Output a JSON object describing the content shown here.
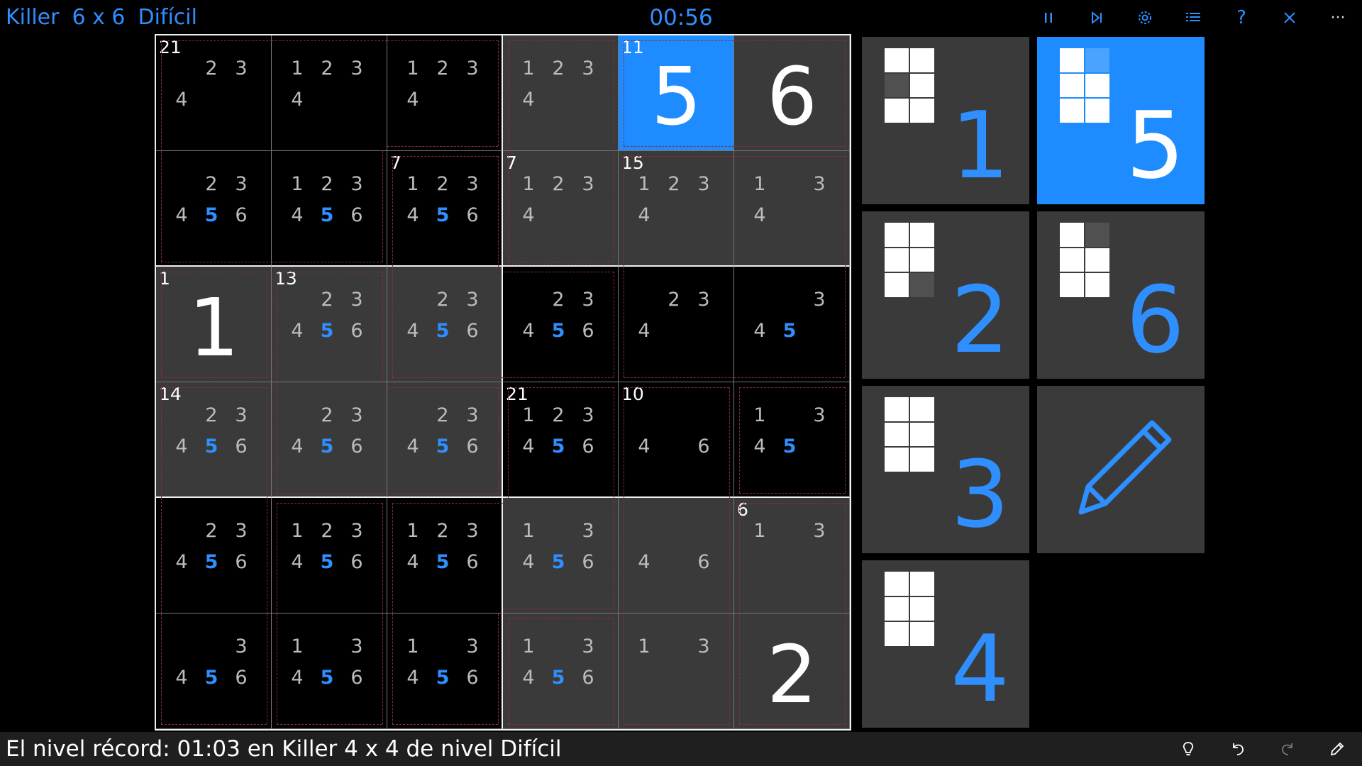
{
  "header": {
    "game_name": "Killer",
    "size": "6 x 6",
    "difficulty": "Difícil",
    "timer": "00:56",
    "icons": [
      "pause-icon",
      "skip-icon",
      "settings-icon",
      "list-icon",
      "help-icon",
      "close-icon",
      "more-icon"
    ],
    "more_label": "···",
    "help_label": "?"
  },
  "colors": {
    "accent": "#2f8fff",
    "selected_cell": "#1e8cff",
    "dark_cell": "#000000",
    "gray_cell": "#3a3a3a",
    "cage_border": "#8c2c3c"
  },
  "board": {
    "selected": [
      0,
      4
    ],
    "shade": [
      [
        0,
        0,
        0,
        1,
        1,
        1
      ],
      [
        0,
        0,
        0,
        1,
        1,
        1
      ],
      [
        1,
        1,
        1,
        0,
        0,
        0
      ],
      [
        1,
        1,
        1,
        0,
        0,
        0
      ],
      [
        0,
        0,
        0,
        1,
        1,
        1
      ],
      [
        0,
        0,
        0,
        1,
        1,
        1
      ]
    ],
    "cells": [
      [
        {
          "sum": "21",
          "cands": [
            "",
            "2",
            "3",
            "4",
            "",
            ""
          ],
          "hl": []
        },
        {
          "sum": "",
          "cands": [
            "1",
            "2",
            "3",
            "4",
            "",
            ""
          ],
          "hl": []
        },
        {
          "sum": "",
          "cands": [
            "1",
            "2",
            "3",
            "4",
            "",
            ""
          ],
          "hl": []
        },
        {
          "sum": "",
          "cands": [
            "1",
            "2",
            "3",
            "4",
            "",
            ""
          ],
          "hl": []
        },
        {
          "sum": "11",
          "value": "5"
        },
        {
          "sum": "",
          "value": "6"
        }
      ],
      [
        {
          "sum": "",
          "cands": [
            "",
            "2",
            "3",
            "4",
            "5",
            "6"
          ],
          "hl": [
            4
          ]
        },
        {
          "sum": "",
          "cands": [
            "1",
            "2",
            "3",
            "4",
            "5",
            "6"
          ],
          "hl": [
            4
          ]
        },
        {
          "sum": "7",
          "cands": [
            "1",
            "2",
            "3",
            "4",
            "5",
            "6"
          ],
          "hl": [
            4
          ]
        },
        {
          "sum": "7",
          "cands": [
            "1",
            "2",
            "3",
            "4",
            "",
            ""
          ],
          "hl": []
        },
        {
          "sum": "15",
          "cands": [
            "1",
            "2",
            "3",
            "4",
            "",
            ""
          ],
          "hl": []
        },
        {
          "sum": "",
          "cands": [
            "1",
            "",
            "3",
            "4",
            "",
            ""
          ],
          "hl": []
        }
      ],
      [
        {
          "sum": "1",
          "value": "1"
        },
        {
          "sum": "13",
          "cands": [
            "",
            "2",
            "3",
            "4",
            "5",
            "6"
          ],
          "hl": [
            4
          ]
        },
        {
          "sum": "",
          "cands": [
            "",
            "2",
            "3",
            "4",
            "5",
            "6"
          ],
          "hl": [
            4
          ]
        },
        {
          "sum": "",
          "cands": [
            "",
            "2",
            "3",
            "4",
            "5",
            "6"
          ],
          "hl": [
            4
          ]
        },
        {
          "sum": "",
          "cands": [
            "",
            "2",
            "3",
            "4",
            "",
            ""
          ],
          "hl": []
        },
        {
          "sum": "",
          "cands": [
            "",
            "",
            "3",
            "4",
            "5",
            ""
          ],
          "hl": [
            4
          ]
        }
      ],
      [
        {
          "sum": "14",
          "cands": [
            "",
            "2",
            "3",
            "4",
            "5",
            "6"
          ],
          "hl": [
            4
          ]
        },
        {
          "sum": "",
          "cands": [
            "",
            "2",
            "3",
            "4",
            "5",
            "6"
          ],
          "hl": [
            4
          ]
        },
        {
          "sum": "",
          "cands": [
            "",
            "2",
            "3",
            "4",
            "5",
            "6"
          ],
          "hl": [
            4
          ]
        },
        {
          "sum": "21",
          "cands": [
            "1",
            "2",
            "3",
            "4",
            "5",
            "6"
          ],
          "hl": [
            4
          ]
        },
        {
          "sum": "10",
          "cands": [
            "",
            "",
            "",
            "4",
            "",
            "6"
          ],
          "hl": []
        },
        {
          "sum": "",
          "cands": [
            "1",
            "",
            "3",
            "4",
            "5",
            ""
          ],
          "hl": [
            4
          ]
        }
      ],
      [
        {
          "sum": "",
          "cands": [
            "",
            "2",
            "3",
            "4",
            "5",
            "6"
          ],
          "hl": [
            4
          ]
        },
        {
          "sum": "",
          "cands": [
            "1",
            "2",
            "3",
            "4",
            "5",
            "6"
          ],
          "hl": [
            4
          ]
        },
        {
          "sum": "",
          "cands": [
            "1",
            "2",
            "3",
            "4",
            "5",
            "6"
          ],
          "hl": [
            4
          ]
        },
        {
          "sum": "",
          "cands": [
            "1",
            "",
            "3",
            "4",
            "5",
            "6"
          ],
          "hl": [
            4
          ]
        },
        {
          "sum": "",
          "cands": [
            "",
            "",
            "",
            "4",
            "",
            "6"
          ],
          "hl": []
        },
        {
          "sum": "6",
          "cands": [
            "1",
            "",
            "3",
            "",
            "",
            ""
          ],
          "hl": []
        }
      ],
      [
        {
          "sum": "",
          "cands": [
            "",
            "",
            "3",
            "4",
            "5",
            "6"
          ],
          "hl": [
            4
          ]
        },
        {
          "sum": "",
          "cands": [
            "1",
            "",
            "3",
            "4",
            "5",
            "6"
          ],
          "hl": [
            4
          ]
        },
        {
          "sum": "",
          "cands": [
            "1",
            "",
            "3",
            "4",
            "5",
            "6"
          ],
          "hl": [
            4
          ]
        },
        {
          "sum": "",
          "cands": [
            "1",
            "",
            "3",
            "4",
            "5",
            "6"
          ],
          "hl": [
            4
          ]
        },
        {
          "sum": "",
          "cands": [
            "1",
            "",
            "3",
            "",
            "",
            ""
          ],
          "hl": []
        },
        {
          "sum": "",
          "value": "2"
        }
      ]
    ],
    "cages": [
      [
        [
          0,
          0
        ],
        [
          0,
          1
        ],
        [
          0,
          2
        ],
        [
          1,
          0
        ],
        [
          1,
          1
        ]
      ],
      [
        [
          0,
          3
        ],
        [
          1,
          3
        ]
      ],
      [
        [
          0,
          4
        ],
        [
          0,
          5
        ]
      ],
      [
        [
          1,
          2
        ],
        [
          2,
          2
        ],
        [
          2,
          3
        ]
      ],
      [
        [
          1,
          4
        ],
        [
          1,
          5
        ],
        [
          2,
          4
        ],
        [
          2,
          5
        ]
      ],
      [
        [
          2,
          0
        ]
      ],
      [
        [
          2,
          1
        ],
        [
          3,
          1
        ],
        [
          3,
          2
        ]
      ],
      [
        [
          3,
          0
        ],
        [
          4,
          0
        ],
        [
          5,
          0
        ]
      ],
      [
        [
          3,
          3
        ],
        [
          4,
          2
        ],
        [
          4,
          3
        ],
        [
          5,
          2
        ]
      ],
      [
        [
          3,
          4
        ],
        [
          4,
          4
        ],
        [
          5,
          4
        ]
      ],
      [
        [
          3,
          5
        ]
      ],
      [
        [
          4,
          1
        ],
        [
          5,
          1
        ]
      ],
      [
        [
          4,
          5
        ],
        [
          5,
          3
        ],
        [
          5,
          5
        ]
      ]
    ]
  },
  "numpad": {
    "selected": "5",
    "pencil_icon": "pencil-icon",
    "keys": [
      {
        "label": "1",
        "pattern": [
          1,
          1,
          0,
          1,
          1,
          1
        ]
      },
      {
        "label": "5",
        "pattern": [
          1,
          0,
          1,
          1,
          1,
          1
        ]
      },
      {
        "label": "2",
        "pattern": [
          1,
          1,
          1,
          1,
          1,
          0
        ]
      },
      {
        "label": "6",
        "pattern": [
          1,
          0,
          1,
          1,
          1,
          1
        ]
      },
      {
        "label": "3",
        "pattern": [
          1,
          1,
          1,
          1,
          1,
          1
        ]
      },
      {
        "label": "4",
        "pattern": [
          1,
          1,
          1,
          1,
          1,
          1
        ]
      }
    ]
  },
  "status": {
    "text": "El nivel récord: 01:03 en Killer 4 x 4 de nivel Difícil",
    "icons": [
      "hint-icon",
      "undo-icon",
      "redo-icon",
      "edit-icon"
    ]
  }
}
